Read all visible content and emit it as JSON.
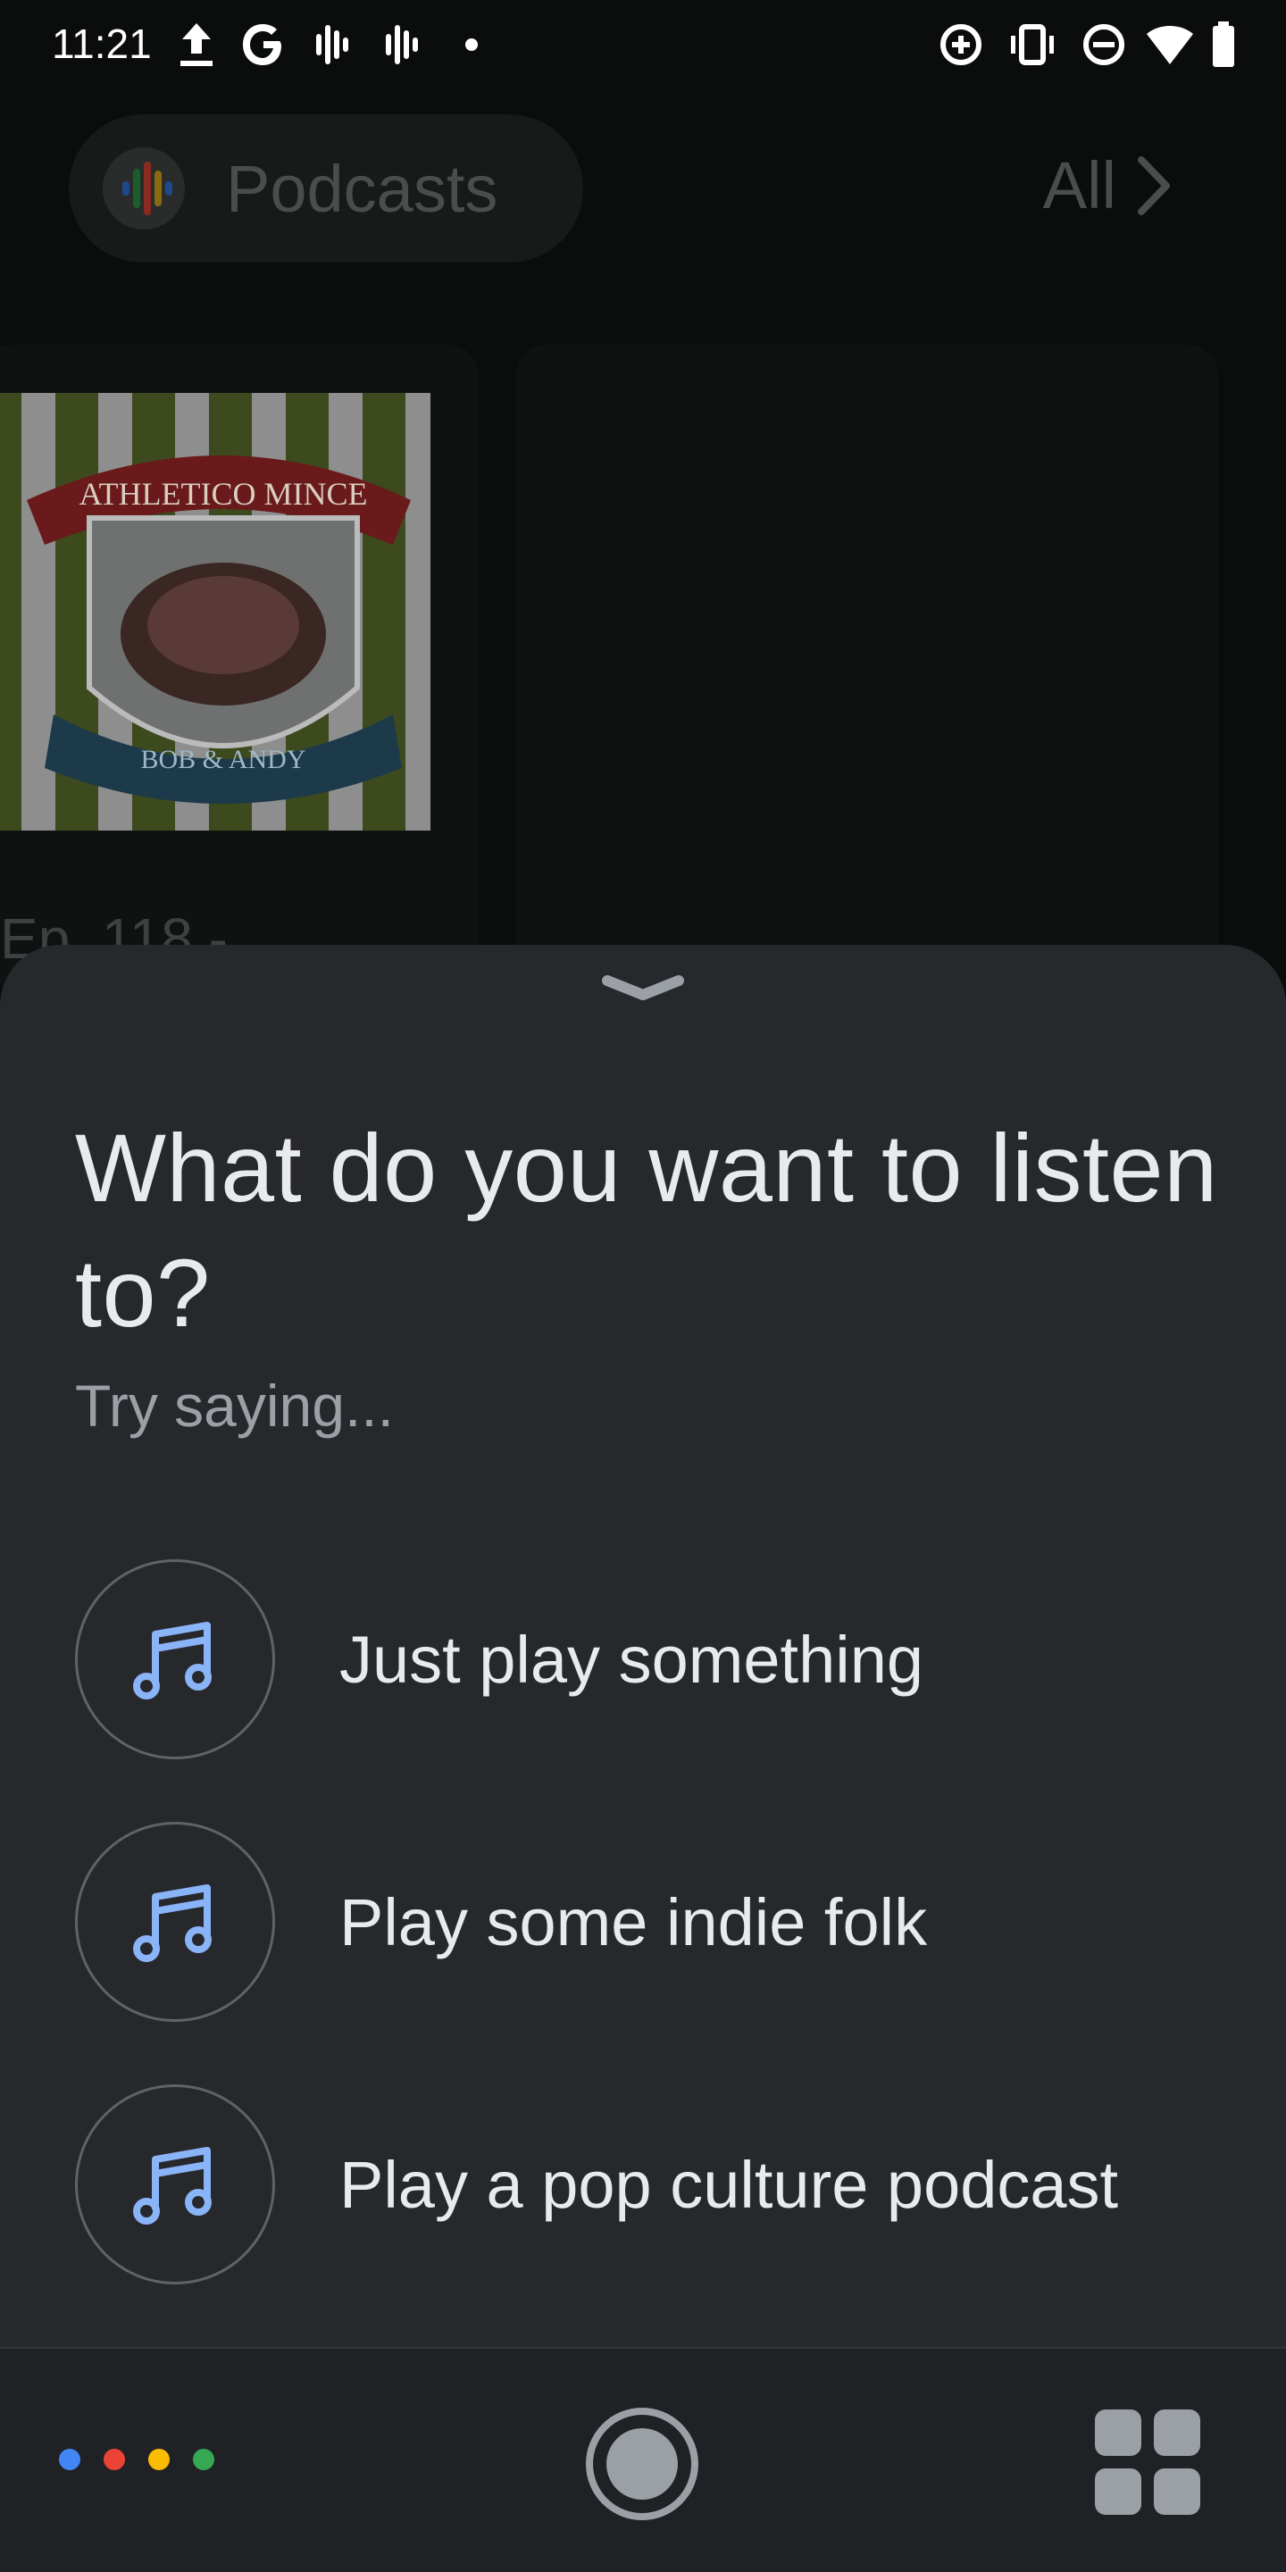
{
  "status_bar": {
    "time": "11:21"
  },
  "background": {
    "chip_title": "Podcasts",
    "all_label": "All",
    "card1": {
      "artwork_banner": "ATHLETICO MINCE",
      "artwork_ribbon": "BOB & ANDY",
      "episode_label": "Ep. 118 -"
    }
  },
  "sheet": {
    "question": "What do you want to listen to?",
    "hint": "Try saying...",
    "suggestions": [
      {
        "label": "Just play something",
        "icon": "music-note-icon"
      },
      {
        "label": "Play some indie folk",
        "icon": "music-note-icon"
      },
      {
        "label": "Play a pop culture podcast",
        "icon": "music-note-icon"
      }
    ]
  },
  "bottom_bar": {
    "dot_colors": [
      "#4285f4",
      "#ea4335",
      "#fbbc04",
      "#34a853"
    ]
  },
  "colors": {
    "sheet_bg": "#27282c",
    "accent_icon": "#8ab4f8"
  }
}
